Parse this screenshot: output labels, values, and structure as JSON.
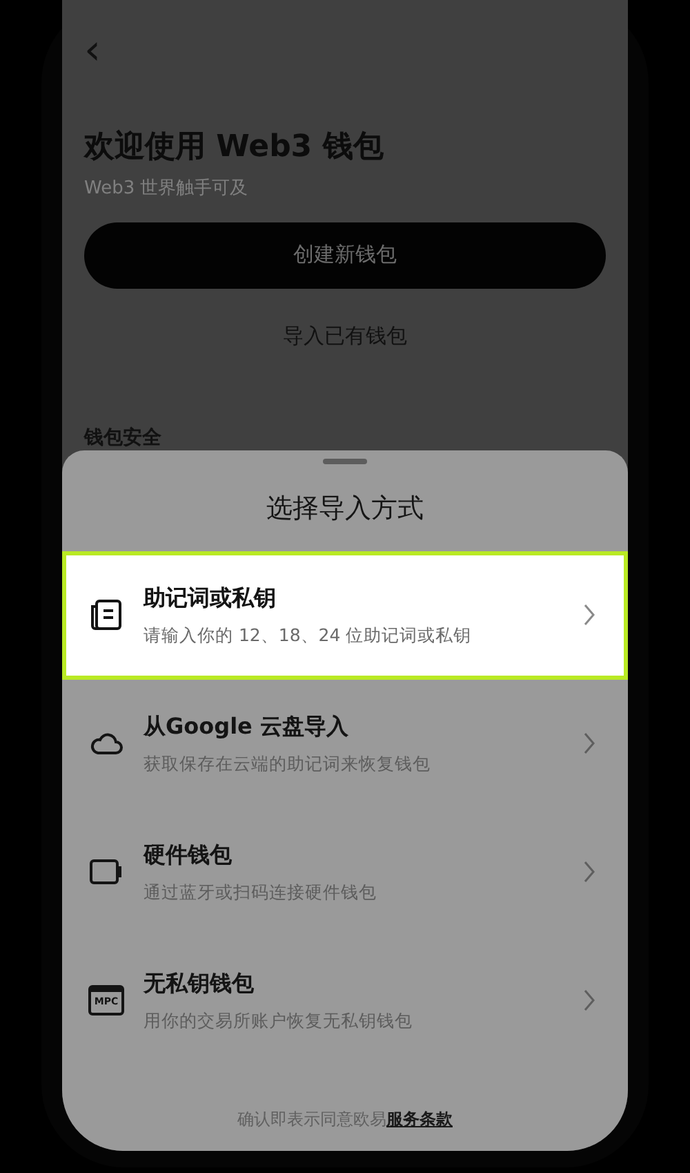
{
  "back": {
    "glyph": "‹"
  },
  "welcome": {
    "title": "欢迎使用 Web3 钱包",
    "subtitle": "Web3 世界触手可及",
    "create_button": "创建新钱包",
    "import_link": "导入已有钱包",
    "section_heading": "钱包安全"
  },
  "sheet": {
    "title": "选择导入方式",
    "options": [
      {
        "kind": "document",
        "title": "助记词或私钥",
        "subtitle": "请输入你的 12、18、24 位助记词或私钥",
        "selected": true
      },
      {
        "kind": "cloud",
        "title": "从Google 云盘导入",
        "subtitle": "获取保存在云端的助记词来恢复钱包",
        "selected": false
      },
      {
        "kind": "device",
        "title": "硬件钱包",
        "subtitle": "通过蓝牙或扫码连接硬件钱包",
        "selected": false
      },
      {
        "kind": "mpc",
        "icon_label": "MPC",
        "title": "无私钥钱包",
        "subtitle": "用你的交易所账户恢复无私钥钱包",
        "selected": false
      }
    ],
    "footer": {
      "text": "确认即表示同意欧易",
      "link": "服务条款"
    }
  }
}
